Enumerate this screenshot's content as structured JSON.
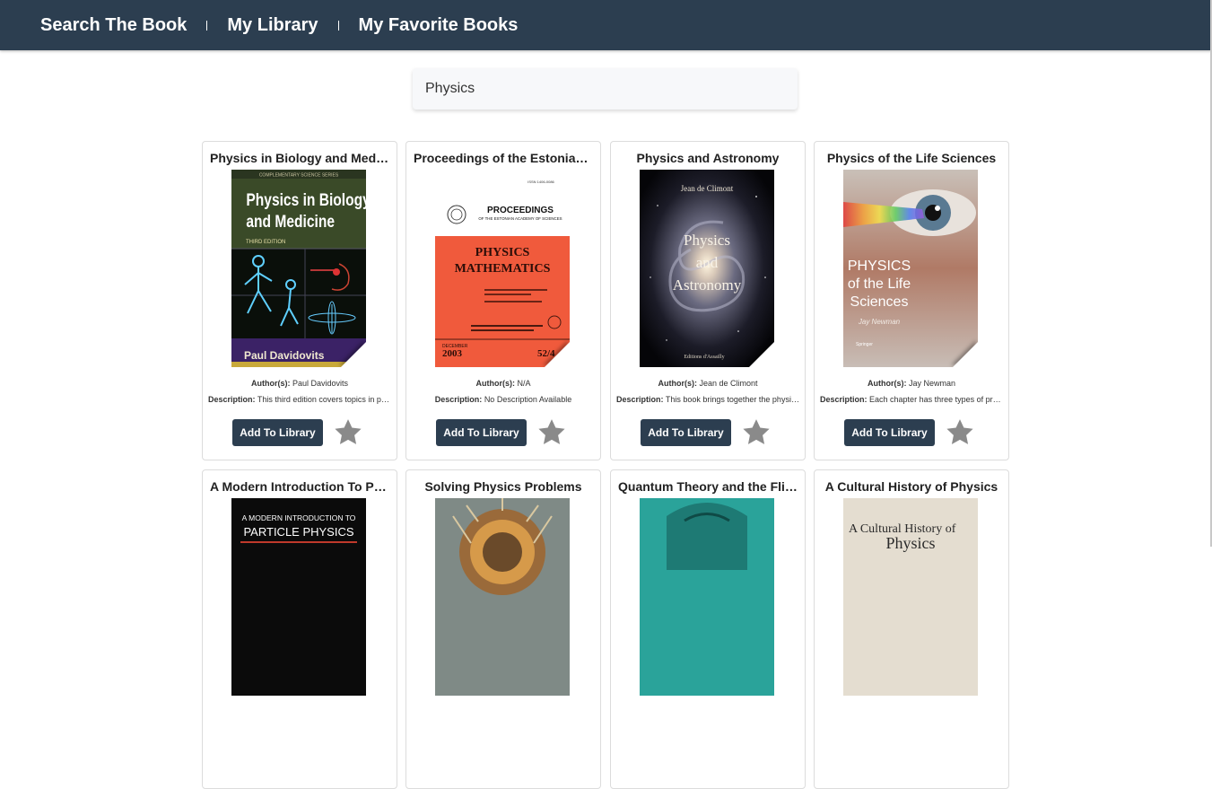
{
  "nav": {
    "items": [
      "Search The Book",
      "My Library",
      "My Favorite Books"
    ]
  },
  "search": {
    "value": "Physics"
  },
  "button_label": "Add To Library",
  "author_label": "Author(s):",
  "description_label": "Description:",
  "books": [
    {
      "title": "Physics in Biology and Medicine",
      "author": "Paul Davidovits",
      "description": "This third edition covers topics in physics as they apply to the life sciences",
      "cover": {
        "lines": [
          "Physics in Biology",
          "and Medicine"
        ],
        "sub": "THIRD EDITION",
        "top": "COMPLEMENTARY SCIENCE SERIES",
        "byline": "Paul Davidovits"
      }
    },
    {
      "title": "Proceedings of the Estonian Academy of Sciences",
      "author": "N/A",
      "description": "No Description Available",
      "cover": {
        "lines": [
          "PHYSICS",
          "MATHEMATICS"
        ],
        "top": "PROCEEDINGS",
        "sub": "OF THE ESTONIAN ACADEMY OF SCIENCES",
        "byline": "2003",
        "vol": "52/4",
        "month": "DECEMBER",
        "issn": "ISSN 1406-0086"
      }
    },
    {
      "title": "Physics and Astronomy",
      "author": "Jean de Climont",
      "description": "This book brings together the physics and astronomy",
      "cover": {
        "lines": [
          "Physics",
          "and",
          "Astronomy"
        ],
        "top": "Jean de Climont",
        "byline": "Editions d'Assailly"
      }
    },
    {
      "title": "Physics of the Life Sciences",
      "author": "Jay Newman",
      "description": "Each chapter has three types of problems",
      "cover": {
        "lines": [
          "PHYSICS",
          "of the Life",
          "Sciences"
        ],
        "byline": "Jay Newman",
        "publisher": "Springer"
      }
    },
    {
      "title": "A Modern Introduction To Particle Physics",
      "cover": {
        "lines": [
          "A MODERN INTRODUCTION TO",
          "PARTICLE PHYSICS"
        ]
      }
    },
    {
      "title": "Solving Physics Problems",
      "cover": {
        "lines": []
      }
    },
    {
      "title": "Quantum Theory and the Flight from Realism",
      "cover": {
        "lines": []
      }
    },
    {
      "title": "A Cultural History of Physics",
      "cover": {
        "lines": [
          "A Cultural History of",
          "Physics"
        ]
      }
    }
  ],
  "colors": {
    "nav_bg": "#2c3e50",
    "button_bg": "#2c3e50",
    "star": "#8a8a8a"
  }
}
